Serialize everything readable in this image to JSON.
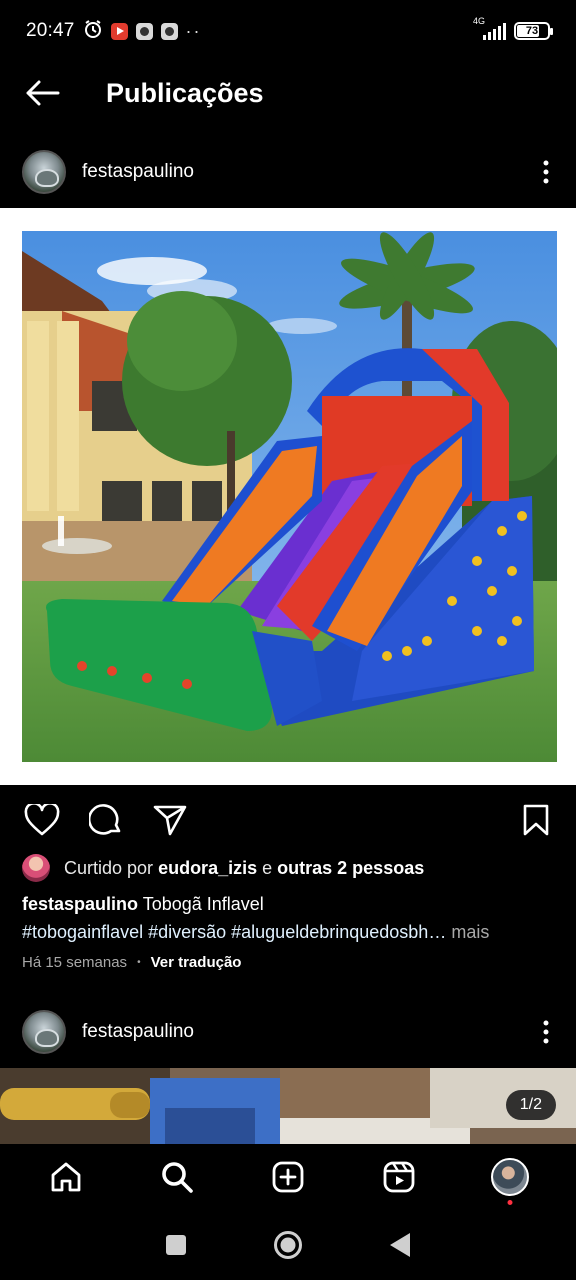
{
  "status_bar": {
    "time": "20:47",
    "network": "4G",
    "battery": "73"
  },
  "header": {
    "title": "Publicações"
  },
  "post": {
    "username": "festaspaulino",
    "liked_by_prefix": "Curtido por",
    "liked_by_user": "eudora_izis",
    "liked_by_connector": "e",
    "liked_by_others": "outras 2 pessoas",
    "caption_user": "festaspaulino",
    "caption_text": "Tobogã Inflavel",
    "hashtags": "#tobogainflavel #diversão #alugueldebrinquedosbh…",
    "more_label": "mais",
    "time_ago": "Há 15 semanas",
    "translate_label": "Ver tradução"
  },
  "next_post": {
    "username": "festaspaulino",
    "page_indicator": "1/2"
  },
  "icons": {
    "back": "arrow-left-icon",
    "more": "more-vertical-icon",
    "like": "heart-icon",
    "comment": "comment-icon",
    "share": "send-icon",
    "save": "bookmark-icon",
    "home": "home-icon",
    "search": "search-icon",
    "create": "plus-square-icon",
    "reels": "reels-icon",
    "profile": "profile-avatar"
  }
}
